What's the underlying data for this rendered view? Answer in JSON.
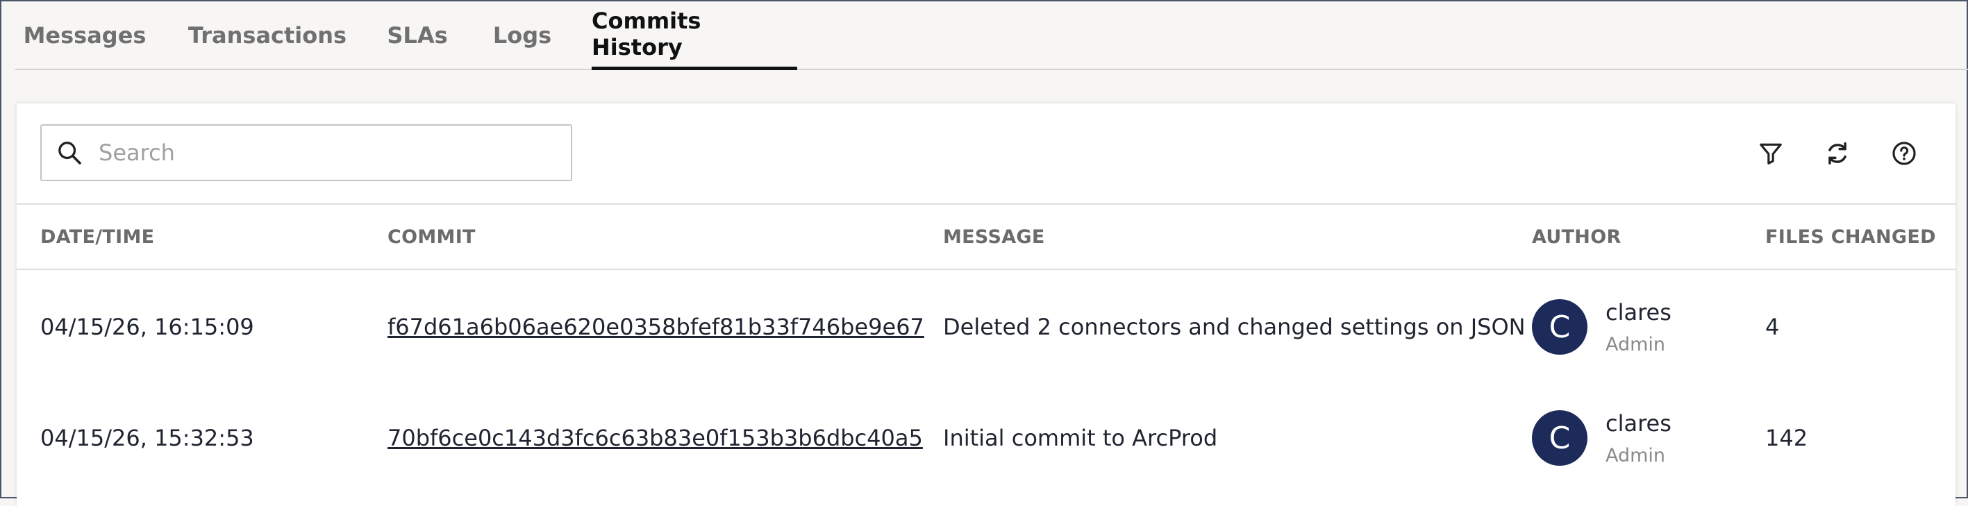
{
  "tabs": [
    {
      "label": "Messages",
      "active": false
    },
    {
      "label": "Transactions",
      "active": false
    },
    {
      "label": "SLAs",
      "active": false
    },
    {
      "label": "Logs",
      "active": false
    },
    {
      "label": "Commits History",
      "active": true
    }
  ],
  "toolbar": {
    "search_placeholder": "Search",
    "search_value": "",
    "icons": [
      "filter-icon",
      "refresh-icon",
      "help-icon"
    ]
  },
  "table": {
    "columns": [
      "DATE/TIME",
      "COMMIT",
      "MESSAGE",
      "AUTHOR",
      "FILES CHANGED"
    ],
    "rows": [
      {
        "datetime": "04/15/26, 16:15:09",
        "commit": "f67d61a6b06ae620e0358bfef81b33f746be9e67",
        "message": "Deleted 2 connectors and changed settings on JSON",
        "author_initial": "C",
        "author_name": "clares",
        "author_role": "Admin",
        "files_changed": "4"
      },
      {
        "datetime": "04/15/26, 15:32:53",
        "commit": "70bf6ce0c143d3fc6c63b83e0f153b3b6dbc40a5",
        "message": "Initial commit to ArcProd",
        "author_initial": "C",
        "author_name": "clares",
        "author_role": "Admin",
        "files_changed": "142"
      }
    ]
  },
  "colors": {
    "avatar_bg": "#1d2b5b",
    "active_tab_underline": "#111111",
    "page_bg": "#f7f6f4"
  }
}
